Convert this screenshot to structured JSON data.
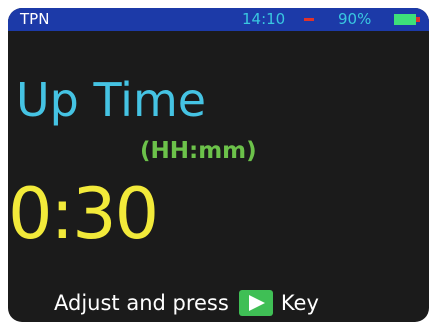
{
  "status_bar": {
    "title": "TPN",
    "time": "14:10",
    "battery_percent": "90%",
    "battery_icon": "battery-icon",
    "colors": {
      "bar": "#1c3aa8",
      "time": "#39c7e0",
      "dash": "#e0332a",
      "battery_fill": "#3ee07a"
    }
  },
  "main": {
    "heading": "Up Time",
    "unit_label": "(HH:mm)",
    "value": "0:30",
    "colors": {
      "heading": "#45c3e3",
      "unit": "#6cc24a",
      "value": "#f2ea3a"
    }
  },
  "hint": {
    "prefix": "Adjust and press",
    "key_icon": "play-key-icon",
    "suffix": "Key",
    "key_color": "#3fbf55"
  }
}
